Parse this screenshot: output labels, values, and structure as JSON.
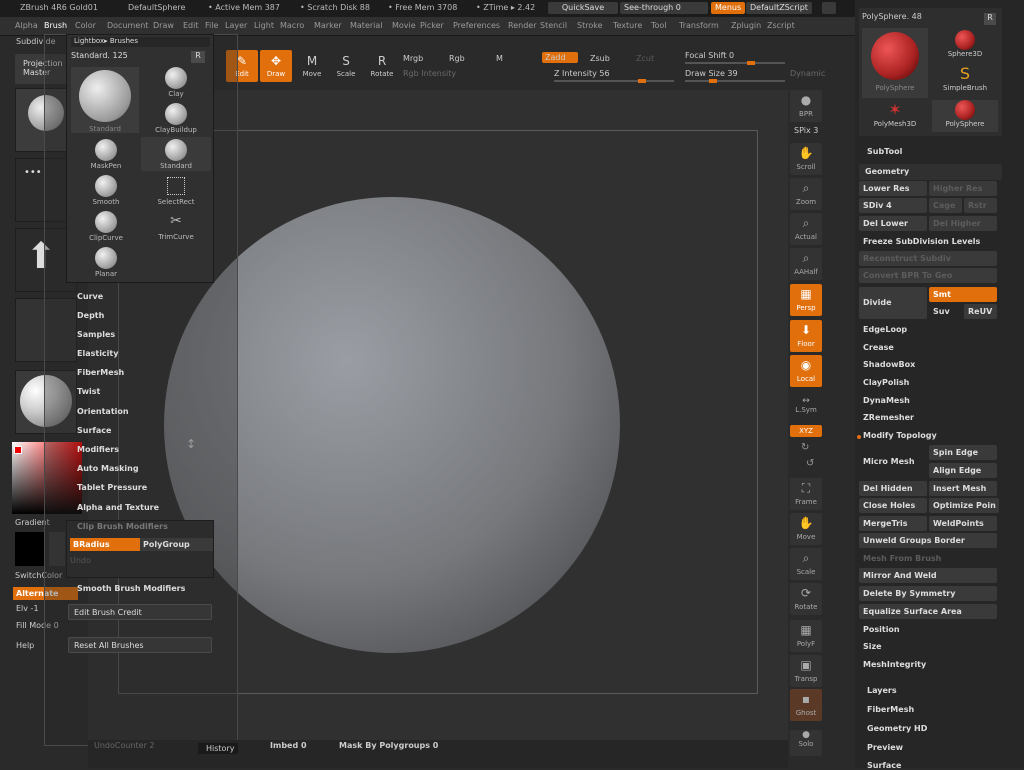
{
  "titlebar": {
    "app": "ZBrush 4R6 Gold01",
    "doc": "DefaultSphere",
    "active_mem": "• Active Mem 387",
    "scratch": "• Scratch Disk 88",
    "free_mem": "• Free Mem 3708",
    "ztime": "• ZTime ▸ 2.42",
    "quicksave": "QuickSave",
    "see_through": "See-through",
    "see_through_value": "0",
    "menus": "Menus",
    "zscript": "DefaultZScript"
  },
  "menubar": [
    "Alpha",
    "Brush",
    "Color",
    "Document",
    "Draw",
    "Edit",
    "File",
    "Layer",
    "Light",
    "Macro",
    "Marker",
    "Material",
    "Movie",
    "Picker",
    "Preferences",
    "Render",
    "Stencil",
    "Stroke",
    "Texture",
    "Tool",
    "Transform",
    "Zplugin",
    "Zscript"
  ],
  "menubar_active": "Brush",
  "toolbar": {
    "edit": "Edit",
    "draw": "Draw",
    "move": "Move",
    "scale": "Scale",
    "rotate": "Rotate",
    "mrgb": "Mrgb",
    "rgb": "Rgb",
    "m": "M",
    "rgb_intensity": "Rgb Intensity",
    "zadd": "Zadd",
    "zsub": "Zsub",
    "zcut": "Zcut",
    "z_intensity": "Z Intensity 56",
    "focal_shift": "Focal Shift 0",
    "draw_size": "Draw Size 39",
    "dynamic": "Dynamic"
  },
  "left_shelf": {
    "subdivide": "Subdivide",
    "projection": "Projection",
    "master": "Master",
    "standard": "Standard",
    "dots": "Dots",
    "brush_alpha": "BrushAlpha",
    "texture_off": "Texture Off",
    "sphere_shader": "SkinShade4",
    "gradient": "Gradient",
    "switch_color": "SwitchColor",
    "alternate": "Alternate",
    "elv": "Elv -1",
    "fill_mode": "Fill Mode 0",
    "help": "Help"
  },
  "brush_popup": {
    "header": "Lightbox▸ Brushes",
    "current": "Standard. 125",
    "r": "R",
    "big_label": "Standard",
    "items": [
      "Clay",
      "ClayBuildup",
      "MaskPen",
      "Standard",
      "Smooth",
      "SelectRect",
      "ClipCurve",
      "TrimCurve",
      "Planar"
    ]
  },
  "brush_menu": {
    "items": [
      "Curve",
      "Depth",
      "Samples",
      "Elasticity",
      "FiberMesh",
      "Twist",
      "Orientation",
      "Surface",
      "Modifiers",
      "Auto Masking",
      "Tablet Pressure",
      "Alpha and Texture"
    ],
    "clip_modifiers": "Clip Brush Modifiers",
    "bradius": "BRadius",
    "polygroup": "PolyGroup",
    "undo": "Undo",
    "smooth_modifiers": "Smooth Brush Modifiers",
    "edit_credit": "Edit Brush Credit",
    "reset_all": "Reset All Brushes"
  },
  "right_tools": {
    "bpr": "BPR",
    "spix": "SPix 3",
    "scroll": "Scroll",
    "zoom": "Zoom",
    "actual": "Actual",
    "aahalf": "AAHalf",
    "persp": "Persp",
    "floor": "Floor",
    "local": "Local",
    "lsym": "L.Sym",
    "xyz": "XYZ",
    "frame": "Frame",
    "move": "Move",
    "scale": "Scale",
    "rotate": "Rotate",
    "polyf": "PolyF",
    "transp": "Transp",
    "ghost": "Ghost",
    "solo": "Solo"
  },
  "tool_panel": {
    "tool_slot": "PolySphere. 48",
    "r": "R",
    "tools": [
      "PolySphere",
      "Sphere3D",
      "SimpleBrush",
      "PolyMesh3D",
      "PolySphere"
    ],
    "subtool": "SubTool",
    "geometry": "Geometry",
    "lower_res": "Lower Res",
    "higher_res": "Higher Res",
    "sdiv": "SDiv 4",
    "cage": "Cage",
    "rstr": "Rstr",
    "del_lower": "Del Lower",
    "del_higher": "Del Higher",
    "freeze": "Freeze SubDivision Levels",
    "reconstruct": "Reconstruct Subdiv",
    "convert_bpr": "Convert BPR To Geo",
    "divide": "Divide",
    "smt": "Smt",
    "suv": "Suv",
    "reuv": "ReUV",
    "edgeloop": "EdgeLoop",
    "crease": "Crease",
    "shadowbox": "ShadowBox",
    "claypolish": "ClayPolish",
    "dynamesh": "DynaMesh",
    "zremesher": "ZRemesher",
    "modify_topology": "Modify Topology",
    "micro_mesh": "Micro Mesh",
    "spin_edge": "Spin Edge",
    "align_edge": "Align Edge",
    "del_hidden": "Del Hidden",
    "insert_mesh": "Insert Mesh",
    "close_holes": "Close Holes",
    "optimize": "Optimize Poin",
    "mergetris": "MergeTris",
    "weldpoints": "WeldPoints",
    "unweld": "Unweld Groups Border",
    "mesh_from_brush": "Mesh From Brush",
    "mirror_weld": "Mirror And Weld",
    "delete_symmetry": "Delete By Symmetry",
    "equalize": "Equalize Surface Area",
    "position": "Position",
    "size": "Size",
    "mesh_integrity": "MeshIntegrity",
    "layers": "Layers",
    "fibermesh": "FiberMesh",
    "geometry_hd": "Geometry HD",
    "preview": "Preview",
    "surface": "Surface"
  },
  "bottom": {
    "undo_counter": "UndoCounter 2",
    "history": "History",
    "imbed": "Imbed 0",
    "mask_poly": "Mask By Polygroups 0"
  },
  "colors": {
    "accent": "#e06f0c",
    "panel": "#262626",
    "canvas": "#303030"
  }
}
